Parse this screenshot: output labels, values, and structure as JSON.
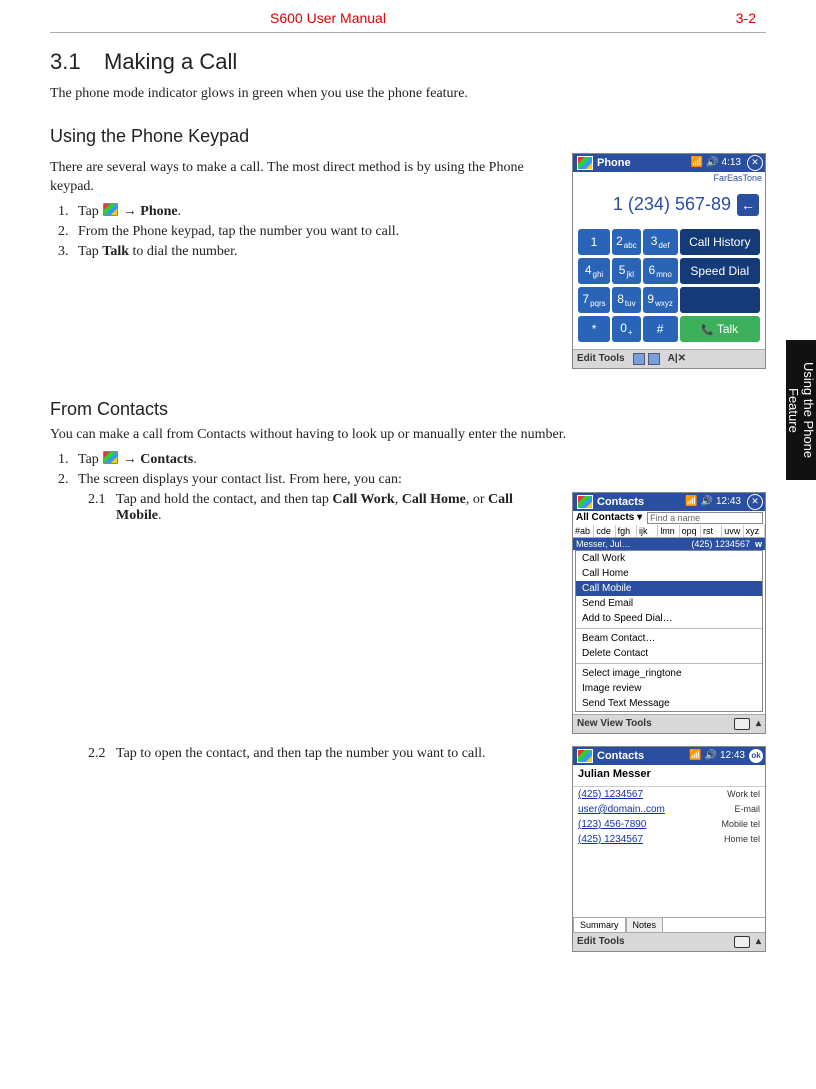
{
  "header": {
    "title": "S600 User Manual",
    "page": "3-2"
  },
  "sidetab": "Using the Phone Feature",
  "s31": {
    "no": "3.1",
    "title": "Making a Call",
    "intro": "The phone mode indicator glows in green when you use the phone feature."
  },
  "keypad": {
    "heading": "Using the Phone Keypad",
    "intro": "There are several ways to make a call. The most direct method is by using the Phone keypad.",
    "steps": {
      "s1a": "Tap ",
      "s1b": " → ",
      "s1c": "Phone",
      "s1d": ".",
      "s2": "From the Phone keypad, tap the number you want to call.",
      "s3a": "Tap ",
      "s3b": "Talk",
      "s3c": " to dial the number."
    }
  },
  "contacts": {
    "heading": "From Contacts",
    "intro": "You can make a call from Contacts without having to look up or manually enter the number.",
    "s1a": "Tap ",
    "s1b": " → ",
    "s1c": "Contacts",
    "s1d": ".",
    "s2": "The screen displays your contact list. From here, you can:",
    "sub1": {
      "n": "2.1",
      "a": "Tap and hold the contact, and then tap ",
      "b": "Call Work",
      "c": ", ",
      "d": "Call Home",
      "e": ", or ",
      "f": "Call Mobile",
      "g": "."
    },
    "sub2": {
      "n": "2.2",
      "t": "Tap to open the contact, and then tap the number you want to call."
    }
  },
  "shot1": {
    "title": "Phone",
    "time": "4:13",
    "carrier": "FarEasTone",
    "dialed": "1 (234) 567-89",
    "keys": [
      [
        "1",
        "2",
        "abc",
        "3",
        "def",
        "Call History"
      ],
      [
        "4",
        "ghi",
        "5",
        "jkl",
        "6",
        "mno",
        "Speed Dial"
      ],
      [
        "7",
        "pqrs",
        "8",
        "tuv",
        "9",
        "wxyz",
        ""
      ],
      [
        "*",
        "",
        "0",
        "+",
        "#",
        "",
        "Talk"
      ]
    ],
    "edit": "Edit Tools",
    "abc": "A|✕"
  },
  "shot2": {
    "title": "Contacts",
    "time": "12:43",
    "all": "All Contacts ▾",
    "find": "Find a name",
    "filters": [
      "#ab",
      "cde",
      "fgh",
      "ijk",
      "lmn",
      "opq",
      "rst",
      "uvw",
      "xyz"
    ],
    "row": {
      "name": "Messer, Jul…",
      "num": "(425) 1234567",
      "tag": "w"
    },
    "menu": [
      "Call Work",
      "Call Home",
      "Call Mobile",
      "Send Email",
      "Add to Speed Dial…",
      "—",
      "Beam Contact…",
      "Delete Contact",
      "—",
      "Select image_ringtone",
      "Image review",
      "Send Text Message"
    ],
    "selected": "Call Mobile",
    "bottom": "New View Tools"
  },
  "shot3": {
    "title": "Contacts",
    "time": "12:43",
    "name": "Julian Messer",
    "rows": [
      {
        "v": "(425) 1234567",
        "k": "Work tel"
      },
      {
        "v": "user@domain..com",
        "k": "E-mail"
      },
      {
        "v": "(123) 456-7890",
        "k": "Mobile tel"
      },
      {
        "v": "(425) 1234567",
        "k": "Home tel"
      }
    ],
    "tabs": [
      "Summary",
      "Notes"
    ],
    "edit": "Edit Tools"
  }
}
